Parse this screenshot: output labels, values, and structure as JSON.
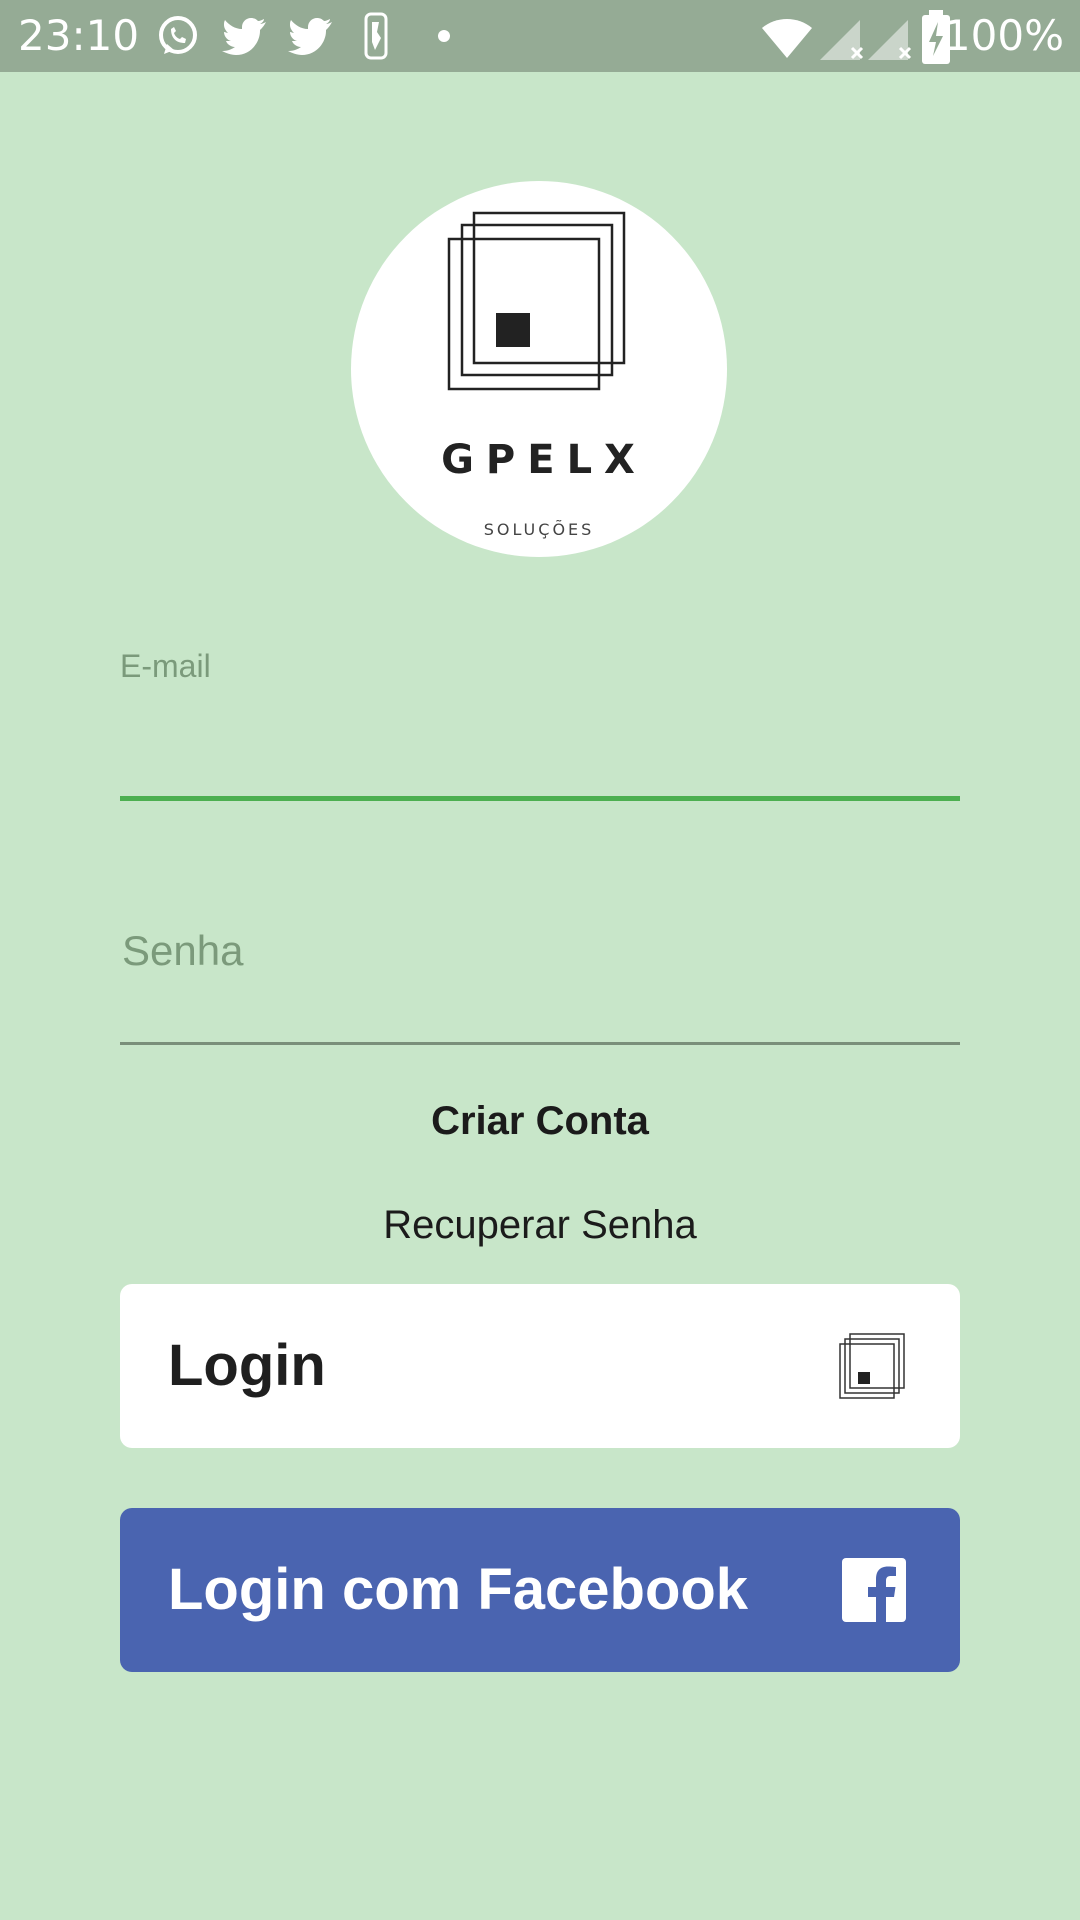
{
  "status_bar": {
    "time": "23:10",
    "battery": "100%",
    "icons": [
      "whatsapp-icon",
      "twitter-icon",
      "twitter-icon",
      "nba-icon",
      "dot-icon",
      "wifi-icon",
      "signal-icon",
      "signal-icon",
      "battery-charging-icon"
    ]
  },
  "logo": {
    "name": "GPELX",
    "subtitle": "SOLUÇÕES"
  },
  "form": {
    "email_label": "E-mail",
    "email_value": "",
    "password_placeholder": "Senha",
    "password_value": ""
  },
  "links": {
    "create_account": "Criar Conta",
    "recover_password": "Recuperar Senha"
  },
  "buttons": {
    "login_label": "Login",
    "facebook_label": "Login com Facebook"
  },
  "colors": {
    "background": "#c8e6c9",
    "status_bar": "#95ab95",
    "accent_green": "#4caf50",
    "facebook_blue": "#4a64b0",
    "white": "#ffffff"
  }
}
